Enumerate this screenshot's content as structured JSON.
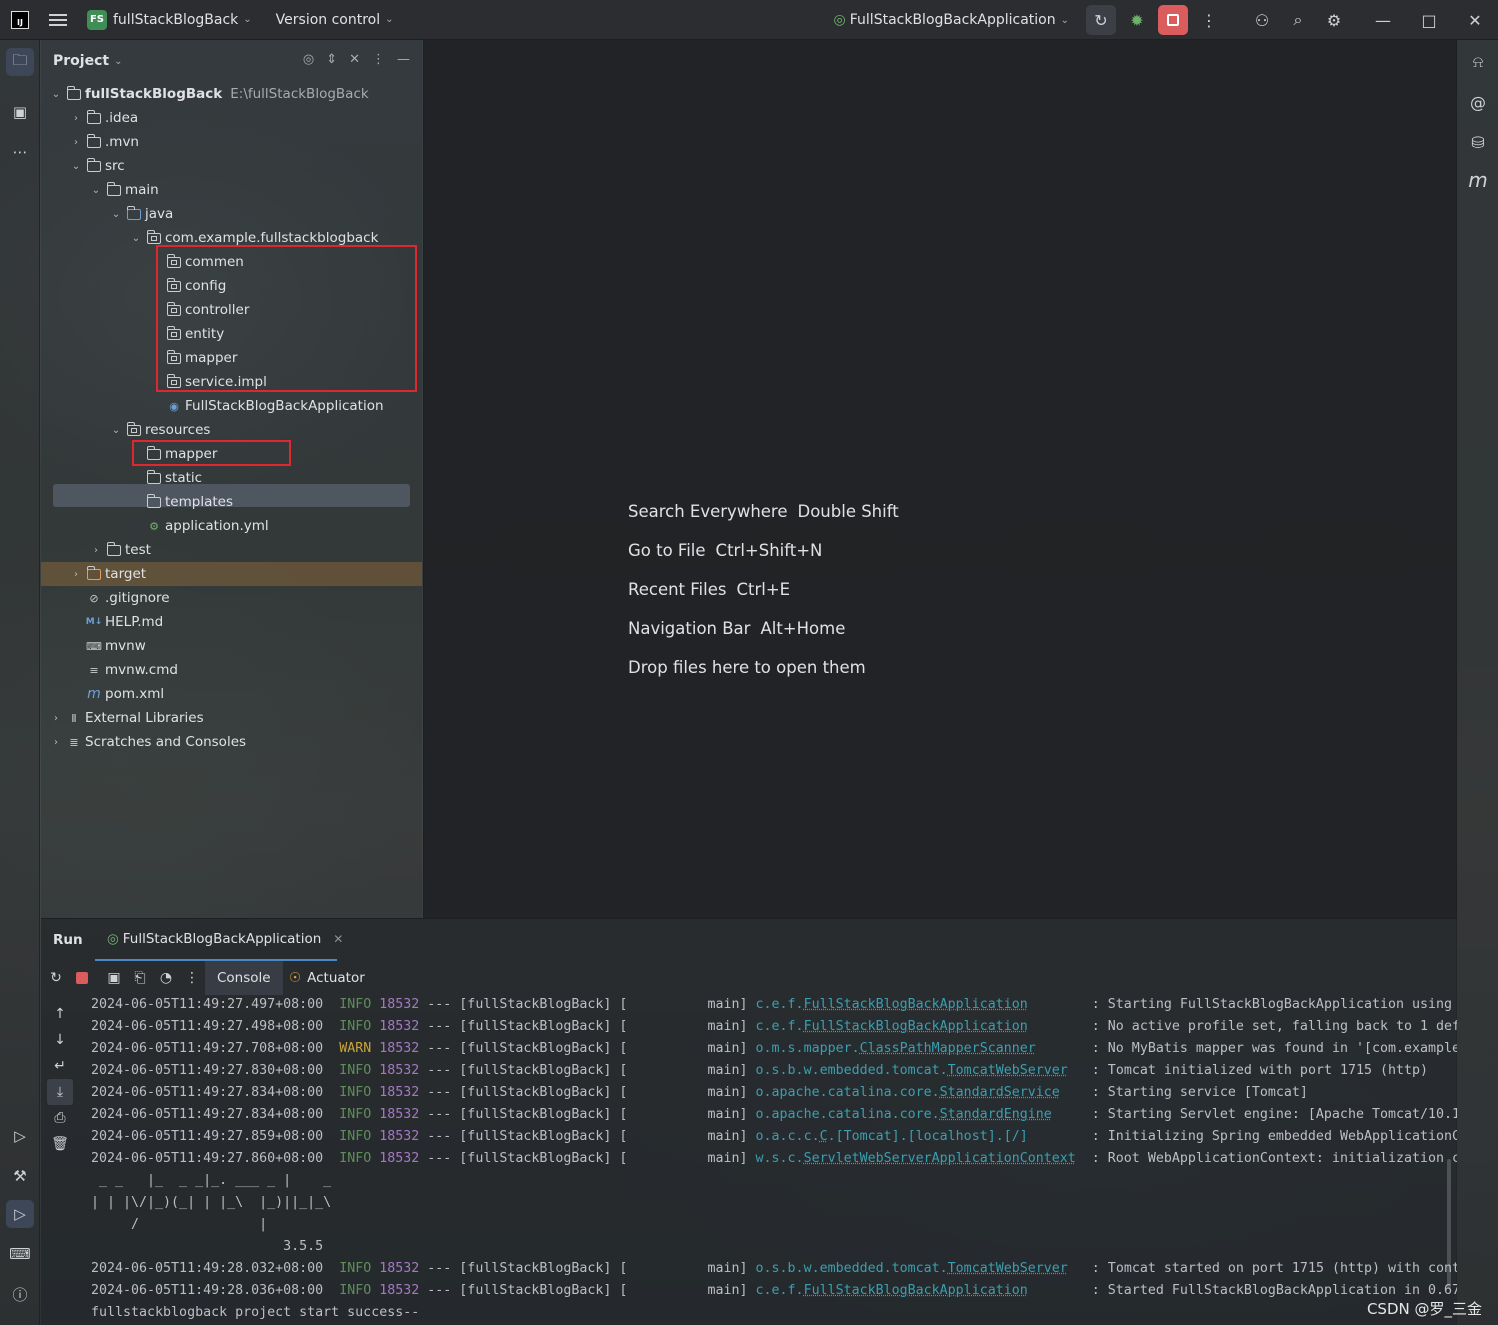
{
  "titlebar": {
    "ide_logo": "IJ",
    "project_badge": "FS",
    "project_name": "fullStackBlogBack",
    "vcs_label": "Version control",
    "run_config": "FullStackBlogBackApplication",
    "accent_run_stop_color": "#db5c5c",
    "project_badge_color": "#3f8e56"
  },
  "project_panel": {
    "title": "Project",
    "tree": [
      {
        "label": "fullStackBlogBack",
        "path": "E:\\fullStackBlogBack",
        "expanded": true,
        "icon": "module-folder-icon"
      },
      {
        "label": ".idea",
        "expanded": false,
        "icon": "folder-icon"
      },
      {
        "label": ".mvn",
        "expanded": false,
        "icon": "folder-icon"
      },
      {
        "label": "src",
        "expanded": true,
        "icon": "folder-icon"
      },
      {
        "label": "main",
        "expanded": true,
        "icon": "folder-icon"
      },
      {
        "label": "java",
        "expanded": true,
        "icon": "source-folder-icon"
      },
      {
        "label": "com.example.fullstackblogback",
        "expanded": true,
        "icon": "package-icon"
      },
      {
        "label": "commen",
        "icon": "package-icon"
      },
      {
        "label": "config",
        "icon": "package-icon"
      },
      {
        "label": "controller",
        "icon": "package-icon"
      },
      {
        "label": "entity",
        "icon": "package-icon"
      },
      {
        "label": "mapper",
        "icon": "package-icon"
      },
      {
        "label": "service.impl",
        "icon": "package-icon"
      },
      {
        "label": "FullStackBlogBackApplication",
        "icon": "spring-class-icon"
      },
      {
        "label": "resources",
        "expanded": true,
        "icon": "resources-folder-icon"
      },
      {
        "label": "mapper",
        "icon": "folder-icon",
        "selected": true
      },
      {
        "label": "static",
        "icon": "folder-icon"
      },
      {
        "label": "templates",
        "icon": "folder-icon"
      },
      {
        "label": "application.yml",
        "icon": "yaml-icon"
      },
      {
        "label": "test",
        "expanded": false,
        "icon": "folder-icon"
      },
      {
        "label": "target",
        "expanded": false,
        "icon": "excluded-folder-icon"
      },
      {
        "label": ".gitignore",
        "icon": "ignore-file-icon"
      },
      {
        "label": "HELP.md",
        "icon": "markdown-icon"
      },
      {
        "label": "mvnw",
        "icon": "shell-icon"
      },
      {
        "label": "mvnw.cmd",
        "icon": "text-file-icon"
      },
      {
        "label": "pom.xml",
        "icon": "maven-icon"
      },
      {
        "label": "External Libraries",
        "expanded": false,
        "icon": "library-icon"
      },
      {
        "label": "Scratches and Consoles",
        "expanded": false,
        "icon": "scratches-icon"
      }
    ]
  },
  "editor": {
    "hints": [
      {
        "label": "Search Everywhere",
        "key": "Double Shift"
      },
      {
        "label": "Go to File",
        "key": "Ctrl+Shift+N"
      },
      {
        "label": "Recent Files",
        "key": "Ctrl+E"
      },
      {
        "label": "Navigation Bar",
        "key": "Alt+Home"
      },
      {
        "label": "Drop files here to open them",
        "key": ""
      }
    ]
  },
  "run_panel": {
    "label": "Run",
    "tab": "FullStackBlogBackApplication",
    "console_tab": "Console",
    "actuator_tab": "Actuator",
    "log_lines": [
      {
        "ts": "2024-06-05T11:49:27.497+08:00",
        "level": "INFO",
        "pid": "18532",
        "app": "--- [fullStackBlogBack] [",
        "thread": "main]",
        "logger_pkg": "c.e.f.",
        "logger_cls": "FullStackBlogBackApplication",
        "msg": ": Starting FullStackBlogBackApplication using"
      },
      {
        "ts": "2024-06-05T11:49:27.498+08:00",
        "level": "INFO",
        "pid": "18532",
        "app": "--- [fullStackBlogBack] [",
        "thread": "main]",
        "logger_pkg": "c.e.f.",
        "logger_cls": "FullStackBlogBackApplication",
        "msg": ": No active profile set, falling back to 1 def"
      },
      {
        "ts": "2024-06-05T11:49:27.708+08:00",
        "level": "WARN",
        "pid": "18532",
        "app": "--- [fullStackBlogBack] [",
        "thread": "main]",
        "logger_pkg": "o.m.s.mapper.",
        "logger_cls": "ClassPathMapperScanner",
        "msg": ": No MyBatis mapper was found in '[com.example"
      },
      {
        "ts": "2024-06-05T11:49:27.830+08:00",
        "level": "INFO",
        "pid": "18532",
        "app": "--- [fullStackBlogBack] [",
        "thread": "main]",
        "logger_pkg": "o.s.b.w.embedded.tomcat.",
        "logger_cls": "TomcatWebServer",
        "msg": ": Tomcat initialized with port 1715 (http)"
      },
      {
        "ts": "2024-06-05T11:49:27.834+08:00",
        "level": "INFO",
        "pid": "18532",
        "app": "--- [fullStackBlogBack] [",
        "thread": "main]",
        "logger_pkg": "o.apache.catalina.core.",
        "logger_cls": "StandardService",
        "msg": ": Starting service [Tomcat]"
      },
      {
        "ts": "2024-06-05T11:49:27.834+08:00",
        "level": "INFO",
        "pid": "18532",
        "app": "--- [fullStackBlogBack] [",
        "thread": "main]",
        "logger_pkg": "o.apache.catalina.core.",
        "logger_cls": "StandardEngine",
        "msg": ": Starting Servlet engine: [Apache Tomcat/10.1"
      },
      {
        "ts": "2024-06-05T11:49:27.859+08:00",
        "level": "INFO",
        "pid": "18532",
        "app": "--- [fullStackBlogBack] [",
        "thread": "main]",
        "logger_pkg": "o.a.c.c.",
        "logger_cls": "C",
        "logger_rest": ".[Tomcat].[localhost].[/]",
        "msg": ": Initializing Spring embedded WebApplicationC"
      },
      {
        "ts": "2024-06-05T11:49:27.860+08:00",
        "level": "INFO",
        "pid": "18532",
        "app": "--- [fullStackBlogBack] [",
        "thread": "main]",
        "logger_pkg": "w.s.c.",
        "logger_cls": "ServletWebServerApplicationContext",
        "msg": ": Root WebApplicationContext: initialization c"
      }
    ],
    "banner": [
      " _ _   |_  _ _|_. ___ _ |    _",
      "| | |\\/|_)(_| | |_\\  |_)||_|_\\",
      "     /               |",
      "                        3.5.5"
    ],
    "log_lines_2": [
      {
        "ts": "2024-06-05T11:49:28.032+08:00",
        "level": "INFO",
        "pid": "18532",
        "app": "--- [fullStackBlogBack] [",
        "thread": "main]",
        "logger_pkg": "o.s.b.w.embedded.tomcat.",
        "logger_cls": "TomcatWebServer",
        "msg": ": Tomcat started on port 1715 (http) with cont"
      },
      {
        "ts": "2024-06-05T11:49:28.036+08:00",
        "level": "INFO",
        "pid": "18532",
        "app": "--- [fullStackBlogBack] [",
        "thread": "main]",
        "logger_pkg": "c.e.f.",
        "logger_cls": "FullStackBlogBackApplication",
        "msg": ": Started FullStackBlogBackApplication in 0.67"
      }
    ],
    "final_line": "fullstackblogback project start success--"
  },
  "watermark": "CSDN @罗_三金"
}
